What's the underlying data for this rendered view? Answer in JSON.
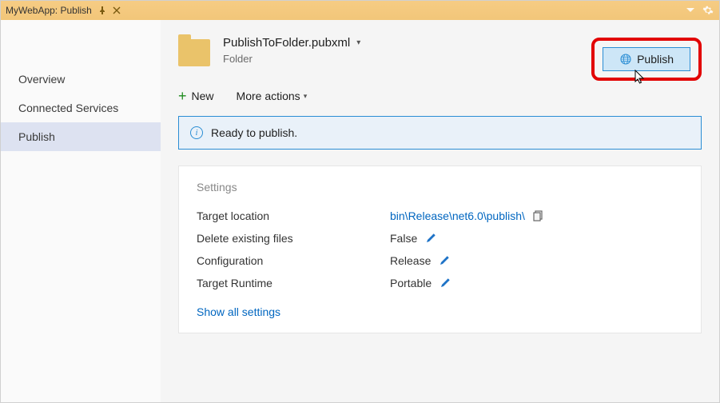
{
  "titlebar": {
    "title": "MyWebApp: Publish"
  },
  "sidebar": {
    "items": [
      {
        "label": "Overview"
      },
      {
        "label": "Connected Services"
      },
      {
        "label": "Publish"
      }
    ]
  },
  "profile": {
    "file_name": "PublishToFolder.pubxml",
    "subtitle": "Folder"
  },
  "publish_button": {
    "label": "Publish"
  },
  "actions": {
    "new_label": "New",
    "more_label": "More actions"
  },
  "status": {
    "text": "Ready to publish."
  },
  "settings": {
    "heading": "Settings",
    "rows": [
      {
        "label": "Target location",
        "value": "bin\\Release\\net6.0\\publish\\",
        "link": true,
        "copy": true,
        "edit": false
      },
      {
        "label": "Delete existing files",
        "value": "False",
        "link": false,
        "copy": false,
        "edit": true
      },
      {
        "label": "Configuration",
        "value": "Release",
        "link": false,
        "copy": false,
        "edit": true
      },
      {
        "label": "Target Runtime",
        "value": "Portable",
        "link": false,
        "copy": false,
        "edit": true
      }
    ],
    "show_all": "Show all settings"
  }
}
